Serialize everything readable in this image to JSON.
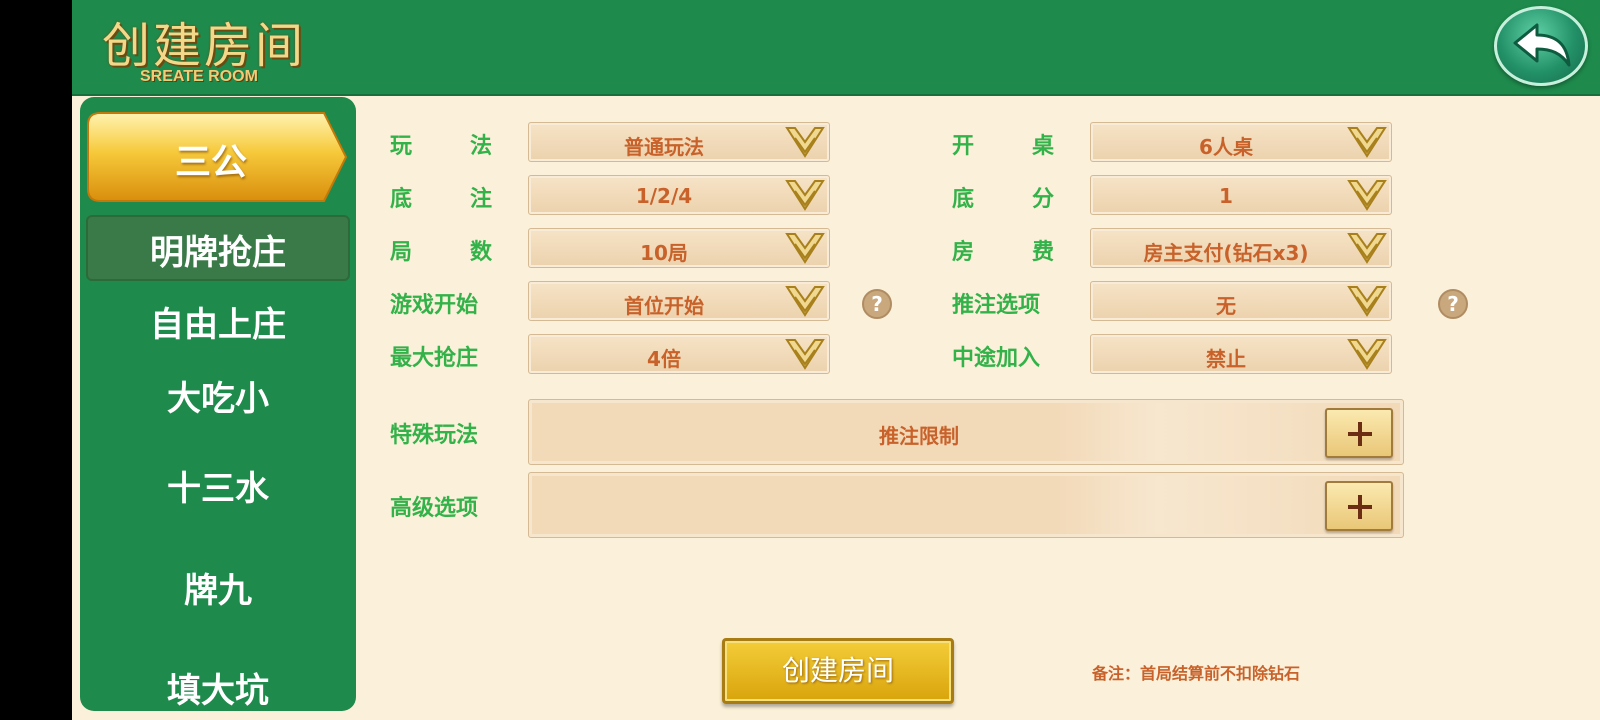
{
  "header": {
    "title": "创建房间",
    "subtitle": "SREATE ROOM",
    "back_icon": "back-arrow-icon"
  },
  "sidebar": {
    "active_tab": "三公",
    "items": [
      "明牌抢庄",
      "自由上庄",
      "大吃小",
      "十三水",
      "牌九",
      "填大坑"
    ],
    "selected_item": "明牌抢庄"
  },
  "form": {
    "rows": [
      {
        "label": "玩法",
        "value": "普通玩法",
        "label2": "开桌",
        "value2": "6人桌"
      },
      {
        "label": "底注",
        "value": "1/2/4",
        "label2": "底分",
        "value2": "1"
      },
      {
        "label": "局数",
        "value": "10局",
        "label2": "房费",
        "value2": "房主支付(钻石x3)"
      },
      {
        "label": "游戏开始",
        "value": "首位开始",
        "label2": "推注选项",
        "value2": "无"
      },
      {
        "label": "最大抢庄",
        "value": "4倍",
        "label2": "中途加入",
        "value2": "禁止"
      }
    ],
    "special": {
      "label": "特殊玩法",
      "value": "推注限制"
    },
    "advanced": {
      "label": "高级选项",
      "value": ""
    },
    "help_glyph": "?"
  },
  "footer": {
    "create_label": "创建房间",
    "note": "备注：首局结算前不扣除钻石"
  },
  "colors": {
    "header_green": "#1e8a4c",
    "background": "#fbf0d9",
    "label_green": "#33b24a",
    "value_orange": "#c8622a",
    "gold": "#e6b520"
  }
}
